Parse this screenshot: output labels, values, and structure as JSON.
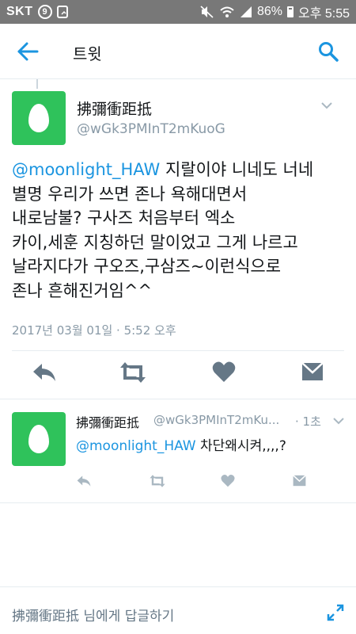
{
  "status_bar": {
    "carrier": "SKT",
    "circle_badge": "9",
    "battery": "86%",
    "time": "오후 5:55"
  },
  "header": {
    "title": "트윗",
    "back_icon": "arrow-left-icon",
    "search_icon": "search-icon"
  },
  "main_tweet": {
    "display_name": "拂彌衝距抵",
    "handle": "@wGk3PMInT2mKuoG",
    "mention": "@moonlight_HAW",
    "text_line1_rest": " 지랄이야 니네도 너네",
    "text_rest": "별명 우리가 쓰면 존나 욕해대면서\n내로남불? 구사즈 처음부터 엑소\n카이,세훈 지칭하던 말이었고 그게 나르고\n날라지다가 구오즈,구삼즈~이런식으로\n존나  흔해진거임^^",
    "timestamp": "2017년 03월 01일 · 5:52 오후",
    "actions": [
      "reply-icon",
      "retweet-icon",
      "like-icon",
      "message-icon"
    ]
  },
  "reply_tweet": {
    "display_name": "拂彌衝距抵",
    "handle": "@wGk3PMInT2mKu...",
    "time": "· 1초",
    "mention": "@moonlight_HAW",
    "text": " 차단왜시켜,,,,?"
  },
  "composer": {
    "placeholder": "拂彌衝距抵 님에게 답글하기",
    "expand_icon": "expand-icon"
  },
  "colors": {
    "accent": "#1b95e0",
    "avatar": "#2fc25b",
    "icon_dark": "#657786",
    "icon_light": "#aab8c2",
    "status_bar": "#787878"
  }
}
